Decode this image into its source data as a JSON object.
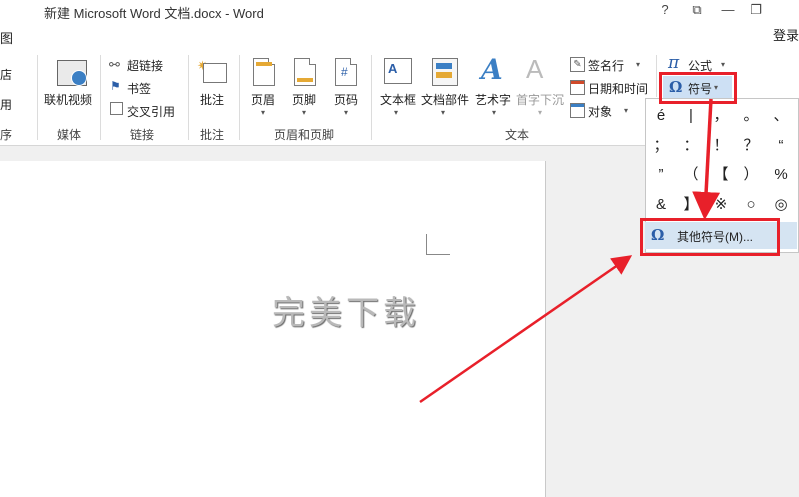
{
  "window": {
    "title": "新建 Microsoft Word 文档.docx - Word",
    "help": "?",
    "restore_icon": "⧉",
    "minimize": "—",
    "maximize": "❐",
    "tab_fragment": "图",
    "login": "登录"
  },
  "ribbon": {
    "left_partial": [
      "店",
      "用",
      "序"
    ],
    "media": {
      "button": "联机视频",
      "group": "媒体"
    },
    "links": {
      "items": [
        "超链接",
        "书签",
        "交叉引用"
      ],
      "group": "链接"
    },
    "comments": {
      "button": "批注",
      "group": "批注"
    },
    "header_footer": {
      "buttons": [
        "页眉",
        "页脚",
        "页码"
      ],
      "group": "页眉和页脚"
    },
    "text": {
      "buttons": [
        "文本框",
        "文档部件",
        "艺术字",
        "首字下沉"
      ],
      "small": [
        "签名行",
        "日期和时间",
        "对象"
      ],
      "group": "文本"
    },
    "symbols": {
      "equation": "公式",
      "symbol": "符号"
    }
  },
  "symbol_dropdown": {
    "symbols": [
      "é",
      "|",
      "，",
      "。",
      "、",
      "；",
      "：",
      "！",
      "？",
      "“",
      "”",
      "（",
      "【",
      "）",
      "%",
      "&",
      "】",
      "※",
      "○",
      "◎"
    ],
    "more": "其他符号(M)..."
  },
  "document": {
    "text": "完美下载"
  },
  "colors": {
    "highlight": "#e8202a",
    "menu_hover": "#d5e4f2",
    "workspace": "#f0f0f0"
  }
}
